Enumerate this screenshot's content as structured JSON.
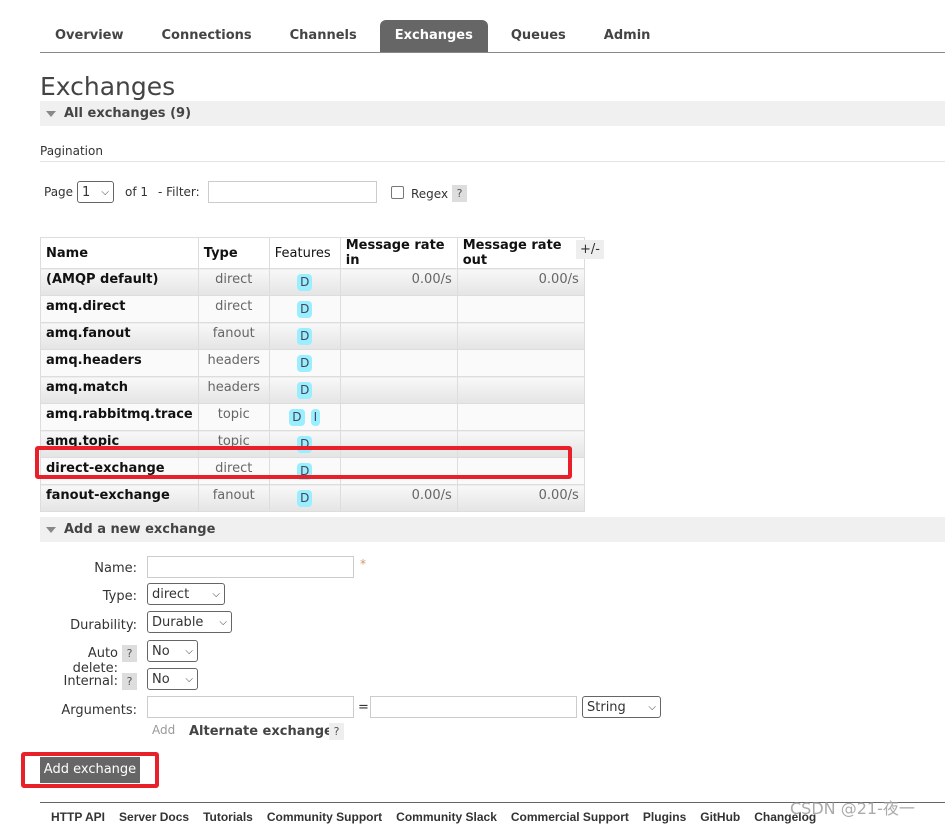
{
  "nav": {
    "tabs": [
      "Overview",
      "Connections",
      "Channels",
      "Exchanges",
      "Queues",
      "Admin"
    ],
    "active": "Exchanges"
  },
  "page_title": "Exchanges",
  "all_section": "All exchanges (9)",
  "pagination": {
    "label": "Pagination",
    "page_label": "Page",
    "page_value": "1",
    "of_label": "of 1",
    "filter_label": "- Filter:",
    "filter_value": "",
    "regex_label": "Regex",
    "help": "?"
  },
  "table": {
    "columns": [
      "Name",
      "Type",
      "Features",
      "Message rate in",
      "Message rate out"
    ],
    "toggle": "+/-",
    "rows": [
      {
        "name": "(AMQP default)",
        "type": "direct",
        "features": [
          "D"
        ],
        "rate_in": "0.00/s",
        "rate_out": "0.00/s"
      },
      {
        "name": "amq.direct",
        "type": "direct",
        "features": [
          "D"
        ],
        "rate_in": "",
        "rate_out": ""
      },
      {
        "name": "amq.fanout",
        "type": "fanout",
        "features": [
          "D"
        ],
        "rate_in": "",
        "rate_out": ""
      },
      {
        "name": "amq.headers",
        "type": "headers",
        "features": [
          "D"
        ],
        "rate_in": "",
        "rate_out": ""
      },
      {
        "name": "amq.match",
        "type": "headers",
        "features": [
          "D"
        ],
        "rate_in": "",
        "rate_out": ""
      },
      {
        "name": "amq.rabbitmq.trace",
        "type": "topic",
        "features": [
          "D",
          "I"
        ],
        "rate_in": "",
        "rate_out": ""
      },
      {
        "name": "amq.topic",
        "type": "topic",
        "features": [
          "D"
        ],
        "rate_in": "",
        "rate_out": ""
      },
      {
        "name": "direct-exchange",
        "type": "direct",
        "features": [
          "D"
        ],
        "rate_in": "",
        "rate_out": ""
      },
      {
        "name": "fanout-exchange",
        "type": "fanout",
        "features": [
          "D"
        ],
        "rate_in": "0.00/s",
        "rate_out": "0.00/s"
      }
    ]
  },
  "add_section": "Add a new exchange",
  "form": {
    "name_label": "Name:",
    "name_value": "",
    "required": "*",
    "type_label": "Type:",
    "type_value": "direct",
    "durability_label": "Durability:",
    "durability_value": "Durable",
    "auto_delete_label": "Auto delete:",
    "auto_delete_value": "No",
    "internal_label": "Internal:",
    "internal_value": "No",
    "arguments_label": "Arguments:",
    "arg_eq": "=",
    "arg_type": "String",
    "add_link": "Add",
    "alt_exchange": "Alternate exchange",
    "help": "?",
    "submit": "Add exchange"
  },
  "footer": [
    "HTTP API",
    "Server Docs",
    "Tutorials",
    "Community Support",
    "Community Slack",
    "Commercial Support",
    "Plugins",
    "GitHub",
    "Changelog"
  ],
  "watermark": "CSDN @21-夜一",
  "colors": {
    "highlight": "#e8202a",
    "active_tab": "#666666",
    "badge": "#99eeff"
  }
}
